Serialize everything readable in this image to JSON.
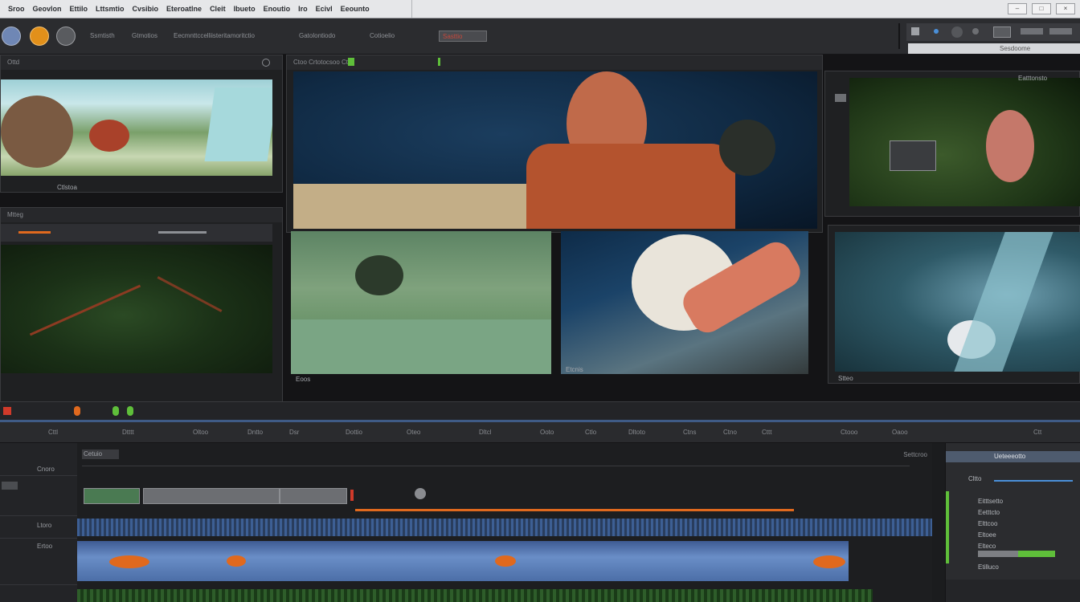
{
  "menubar": {
    "items": [
      "Sroo",
      "Geovlon",
      "Ettilo",
      "Lttsmtio",
      "Cvsibio",
      "Eteroatlne",
      "Cleit",
      "Ibueto",
      "Enoutio",
      "Iro",
      "Ecivl",
      "Eeounto"
    ]
  },
  "toolbar": {
    "labels": [
      "Ssmtisth",
      "Gtmotios",
      "Eecmnttccelliisteritamoritctio",
      "Gatolontiodo",
      "Cotioelio",
      "Sesdoome"
    ],
    "field_value": "Sasttio"
  },
  "viewer": {
    "left_top_title": "Ottd",
    "left_top_caption": "Ctlstoa",
    "left_mid_title": "Mtteg",
    "center_title": "Ctoo Crtotocsoo Cttt",
    "center_caption_left": "Eoos",
    "center_caption_mid": "Etcnis",
    "right_title": "Eatttonsto",
    "right_caption": "Stteo"
  },
  "timeline": {
    "ruler_ticks": [
      "Cttl",
      "Dtttt",
      "Oltoo",
      "Dntto",
      "Dsr",
      "Dottio",
      "Oteo",
      "Dltcl",
      "Ooto",
      "Ctlo",
      "Dltoto",
      "Ctns",
      "Ctno",
      "Cttt",
      "Ctooo",
      "Oaoo",
      "Ctt"
    ],
    "tracks": [
      "Cnoro",
      "Ltoro",
      "Ertoo"
    ],
    "track_top_label": "Cetuio",
    "right_readout": "Settcroo"
  },
  "inspector": {
    "title": "Ueteeeotto",
    "lines": [
      "Cltto",
      "Eitttsetto",
      "Eetttcto",
      "Elttcoo",
      "Eltoee",
      "Elteco",
      "Etilluco"
    ]
  },
  "colors": {
    "accent_orange": "#e0691e",
    "accent_green": "#5fbf3a",
    "accent_red": "#d03a2a",
    "audio_blue": "#3d5f94"
  }
}
